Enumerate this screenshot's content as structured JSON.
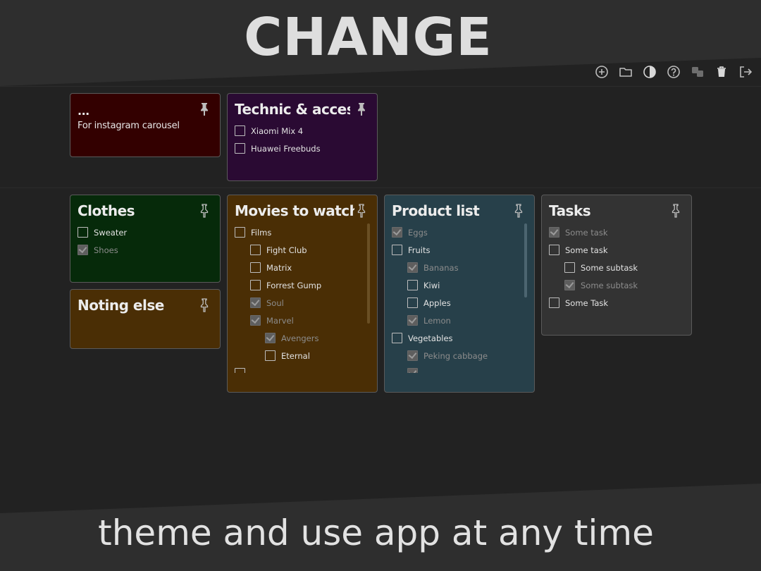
{
  "promo": {
    "headline": "CHANGE",
    "tagline": "theme and use app at any time"
  },
  "toolbar": {
    "icons": [
      "add-icon",
      "folder-icon",
      "theme-contrast-icon",
      "help-icon",
      "translate-icon",
      "trash-icon",
      "logout-icon"
    ]
  },
  "notes": {
    "ellipsis": {
      "title": "...",
      "text": "For instagram carousel",
      "color": "#330000"
    },
    "technic": {
      "title": "Technic & accessories",
      "items": [
        "Xiaomi Mix 4",
        "Huawei Freebuds"
      ],
      "color": "#2a0a33"
    },
    "clothes": {
      "title": "Clothes",
      "items": [
        "Sweater",
        "Shoes"
      ],
      "color": "#062a0a"
    },
    "noting": {
      "title": "Noting else",
      "color": "#4a2e05"
    },
    "movies": {
      "title": "Movies to watch",
      "items": [
        "Films",
        "Fight Club",
        "Matrix",
        "Forrest Gump",
        "Soul",
        "Marvel",
        "Avengers",
        "Eternal"
      ],
      "color": "#4a2e05"
    },
    "products": {
      "title": "Product list",
      "items": [
        "Eggs",
        "Fruits",
        "Bananas",
        "Kiwi",
        "Apples",
        "Lemon",
        "Vegetables",
        "Peking cabbage"
      ],
      "color": "#27404a"
    },
    "tasks": {
      "title": "Tasks",
      "items": [
        "Some task",
        "Some task",
        "Some subtask",
        "Some subtask",
        "Some Task"
      ],
      "color": "#333333"
    }
  }
}
